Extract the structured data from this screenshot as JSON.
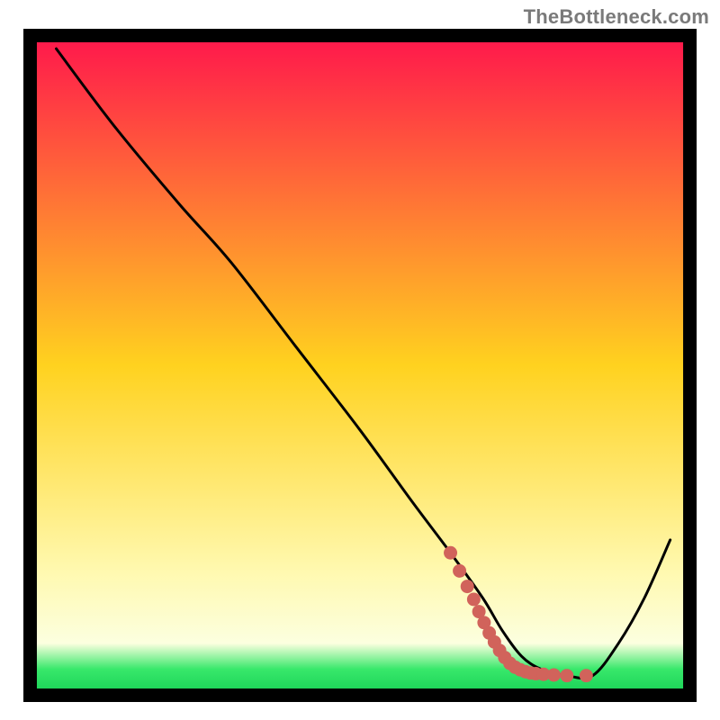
{
  "watermark": "TheBottleneck.com",
  "chart_data": {
    "type": "line",
    "title": "",
    "xlabel": "",
    "ylabel": "",
    "xlim": [
      0,
      100
    ],
    "ylim": [
      0,
      100
    ],
    "grid": false,
    "legend": false,
    "gradient_stops": [
      {
        "offset": 0.0,
        "color": "#ff1a4b"
      },
      {
        "offset": 0.5,
        "color": "#ffd21f"
      },
      {
        "offset": 0.82,
        "color": "#fff9b0"
      },
      {
        "offset": 0.93,
        "color": "#fcffdf"
      },
      {
        "offset": 0.97,
        "color": "#38e86b"
      },
      {
        "offset": 1.0,
        "color": "#1fd65a"
      }
    ],
    "series": [
      {
        "name": "bottleneck-curve",
        "color": "#000000",
        "x": [
          3,
          12,
          22,
          30,
          40,
          50,
          58,
          64,
          69,
          72,
          75,
          78,
          82,
          86,
          90,
          94,
          98
        ],
        "y": [
          99,
          87,
          75,
          66,
          53,
          40,
          29,
          21,
          14,
          9,
          5,
          3,
          2,
          2,
          7,
          14,
          23
        ]
      }
    ],
    "highlight": {
      "color": "#d1635b",
      "dot_radius_percent": 1.0,
      "points": [
        {
          "x": 64.0,
          "y": 21.0
        },
        {
          "x": 65.4,
          "y": 18.2
        },
        {
          "x": 66.6,
          "y": 15.8
        },
        {
          "x": 67.6,
          "y": 13.8
        },
        {
          "x": 68.4,
          "y": 11.9
        },
        {
          "x": 69.2,
          "y": 10.2
        },
        {
          "x": 70.0,
          "y": 8.6
        },
        {
          "x": 70.8,
          "y": 7.2
        },
        {
          "x": 71.6,
          "y": 5.9
        },
        {
          "x": 72.4,
          "y": 4.8
        },
        {
          "x": 73.2,
          "y": 3.9
        },
        {
          "x": 74.0,
          "y": 3.3
        },
        {
          "x": 74.8,
          "y": 2.9
        },
        {
          "x": 75.6,
          "y": 2.6
        },
        {
          "x": 76.4,
          "y": 2.4
        },
        {
          "x": 77.2,
          "y": 2.3
        },
        {
          "x": 78.4,
          "y": 2.2
        },
        {
          "x": 80.0,
          "y": 2.1
        },
        {
          "x": 82.0,
          "y": 2.0
        },
        {
          "x": 85.0,
          "y": 2.0
        }
      ]
    }
  }
}
